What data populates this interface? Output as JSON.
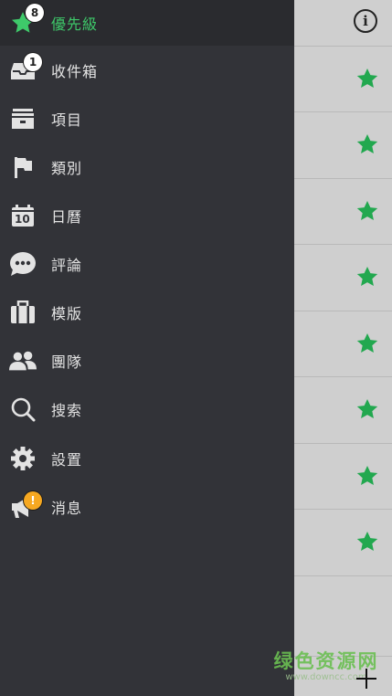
{
  "colors": {
    "drawer_bg": "#323338",
    "accent_green": "#3ec96a",
    "badge_warning": "#f6a821",
    "panel_bg": "#cfcfcf"
  },
  "menu": [
    {
      "label": "優先級",
      "icon": "star-icon",
      "badge": "8",
      "active": true
    },
    {
      "label": "收件箱",
      "icon": "inbox-icon",
      "badge": "1"
    },
    {
      "label": "項目",
      "icon": "project-icon"
    },
    {
      "label": "類別",
      "icon": "flag-icon"
    },
    {
      "label": "日曆",
      "icon": "calendar-icon",
      "icon_text": "10"
    },
    {
      "label": "評論",
      "icon": "comment-icon"
    },
    {
      "label": "模版",
      "icon": "briefcase-icon"
    },
    {
      "label": "團隊",
      "icon": "team-icon"
    },
    {
      "label": "搜索",
      "icon": "search-icon"
    },
    {
      "label": "設置",
      "icon": "gear-icon"
    },
    {
      "label": "消息",
      "icon": "megaphone-icon",
      "badge": "!"
    }
  ],
  "right_panel": {
    "info_icon": "info-icon",
    "info_glyph": "i",
    "star_rows": 8,
    "add_icon": "plus-icon"
  },
  "watermark": {
    "title": "绿色资源网",
    "url": "www.downcc.com"
  }
}
